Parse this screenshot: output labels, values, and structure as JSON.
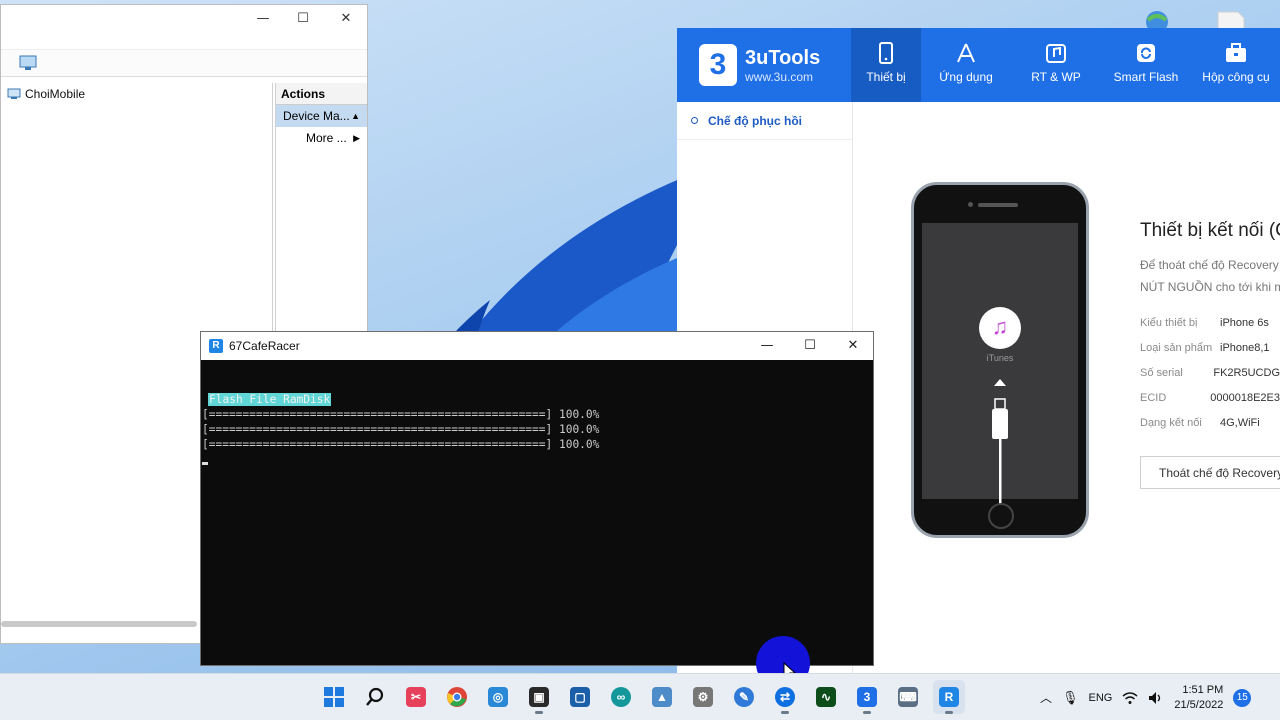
{
  "device_manager": {
    "tree_root": "ChoiMobile",
    "actions_header": "Actions",
    "selected_action": "Device Ma...",
    "more_action": "More ...",
    "window_controls": {
      "minimize": "—",
      "maximize": "☐",
      "close": "✕"
    }
  },
  "tools": {
    "brand": "3uTools",
    "brand_url": "www.3u.com",
    "logo_glyph": "3",
    "nav": [
      {
        "label": "Thiết bị",
        "icon": "phone-icon"
      },
      {
        "label": "Ứng dụng",
        "icon": "appstore-icon"
      },
      {
        "label": "RT & WP",
        "icon": "music-icon"
      },
      {
        "label": "Smart Flash",
        "icon": "refresh-icon"
      },
      {
        "label": "Hộp công cụ",
        "icon": "toolbox-icon"
      }
    ],
    "sidebar_item": "Chế độ phục hồi",
    "itunes_label": "iTunes",
    "info_title": "Thiết bị kết nối (C",
    "info_desc_1": "Để thoát chế độ Recovery",
    "info_desc_2": "NÚT NGUỒN cho tới khi m",
    "info_rows": [
      {
        "key": "Kiểu thiết bị",
        "value": "iPhone 6s"
      },
      {
        "key": "Loại sản phẩm",
        "value": "iPhone8,1"
      },
      {
        "key": "Số serial",
        "value": "FK2R5UCDG"
      },
      {
        "key": "ECID",
        "value": "0000018E2E3"
      },
      {
        "key": "Dạng kết nối",
        "value": "4G,WiFi"
      }
    ],
    "exit_button": "Thoát chế độ Recovery",
    "accent_color": "#1f6fe6"
  },
  "console": {
    "title": "67CafeRacer",
    "heading": "Flash File RamDisk",
    "progress_lines": [
      "[==================================================] 100.0%",
      "[==================================================] 100.0%",
      "[==================================================] 100.0%"
    ],
    "window_controls": {
      "minimize": "—",
      "maximize": "☐",
      "close": "✕"
    }
  },
  "taskbar": {
    "language": "ENG",
    "time": "1:51 PM",
    "date": "21/5/2022",
    "notifications": "15"
  }
}
